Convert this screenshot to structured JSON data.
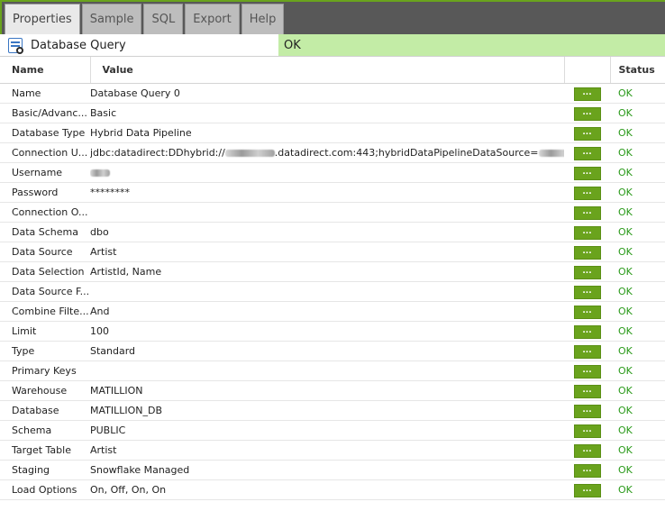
{
  "tabs": [
    {
      "label": "Properties"
    },
    {
      "label": "Sample"
    },
    {
      "label": "SQL"
    },
    {
      "label": "Export"
    },
    {
      "label": "Help"
    }
  ],
  "header": {
    "title": "Database Query",
    "status": "OK",
    "icon": "database-query-icon"
  },
  "columns": {
    "name": "Name",
    "value": "Value",
    "status": "Status"
  },
  "button_label": "...",
  "rows": [
    {
      "name": "Name",
      "value": "Database Query 0",
      "status": "OK"
    },
    {
      "name": "Basic/Advanc...",
      "value": "Basic",
      "status": "OK"
    },
    {
      "name": "Database Type",
      "value": "Hybrid Data Pipeline",
      "status": "OK"
    },
    {
      "name": "Connection U...",
      "value": "jdbc:datadirect:DDhybrid://",
      "value_suffix": ".datadirect.com:443;hybridDataPipelineDataSource=",
      "redacted": true,
      "status": "OK"
    },
    {
      "name": "Username",
      "value": "",
      "redacted_only": true,
      "status": "OK"
    },
    {
      "name": "Password",
      "value": "********",
      "status": "OK"
    },
    {
      "name": "Connection O...",
      "value": "",
      "status": "OK"
    },
    {
      "name": "Data Schema",
      "value": "dbo",
      "status": "OK"
    },
    {
      "name": "Data Source",
      "value": "Artist",
      "status": "OK"
    },
    {
      "name": "Data Selection",
      "value": "ArtistId, Name",
      "status": "OK"
    },
    {
      "name": "Data Source F...",
      "value": "",
      "status": "OK"
    },
    {
      "name": "Combine Filte...",
      "value": "And",
      "status": "OK"
    },
    {
      "name": "Limit",
      "value": "100",
      "status": "OK"
    },
    {
      "name": "Type",
      "value": "Standard",
      "status": "OK"
    },
    {
      "name": "Primary Keys",
      "value": "",
      "status": "OK"
    },
    {
      "name": "Warehouse",
      "value": "MATILLION",
      "status": "OK"
    },
    {
      "name": "Database",
      "value": "MATILLION_DB",
      "status": "OK"
    },
    {
      "name": "Schema",
      "value": "PUBLIC",
      "status": "OK"
    },
    {
      "name": "Target Table",
      "value": "Artist",
      "status": "OK"
    },
    {
      "name": "Staging",
      "value": "Snowflake Managed",
      "status": "OK"
    },
    {
      "name": "Load Options",
      "value": "On, Off, On, On",
      "status": "OK"
    }
  ],
  "colors": {
    "accent": "#6aa31d",
    "ok": "#2a9a1a",
    "status_bg": "#c3eca6"
  }
}
